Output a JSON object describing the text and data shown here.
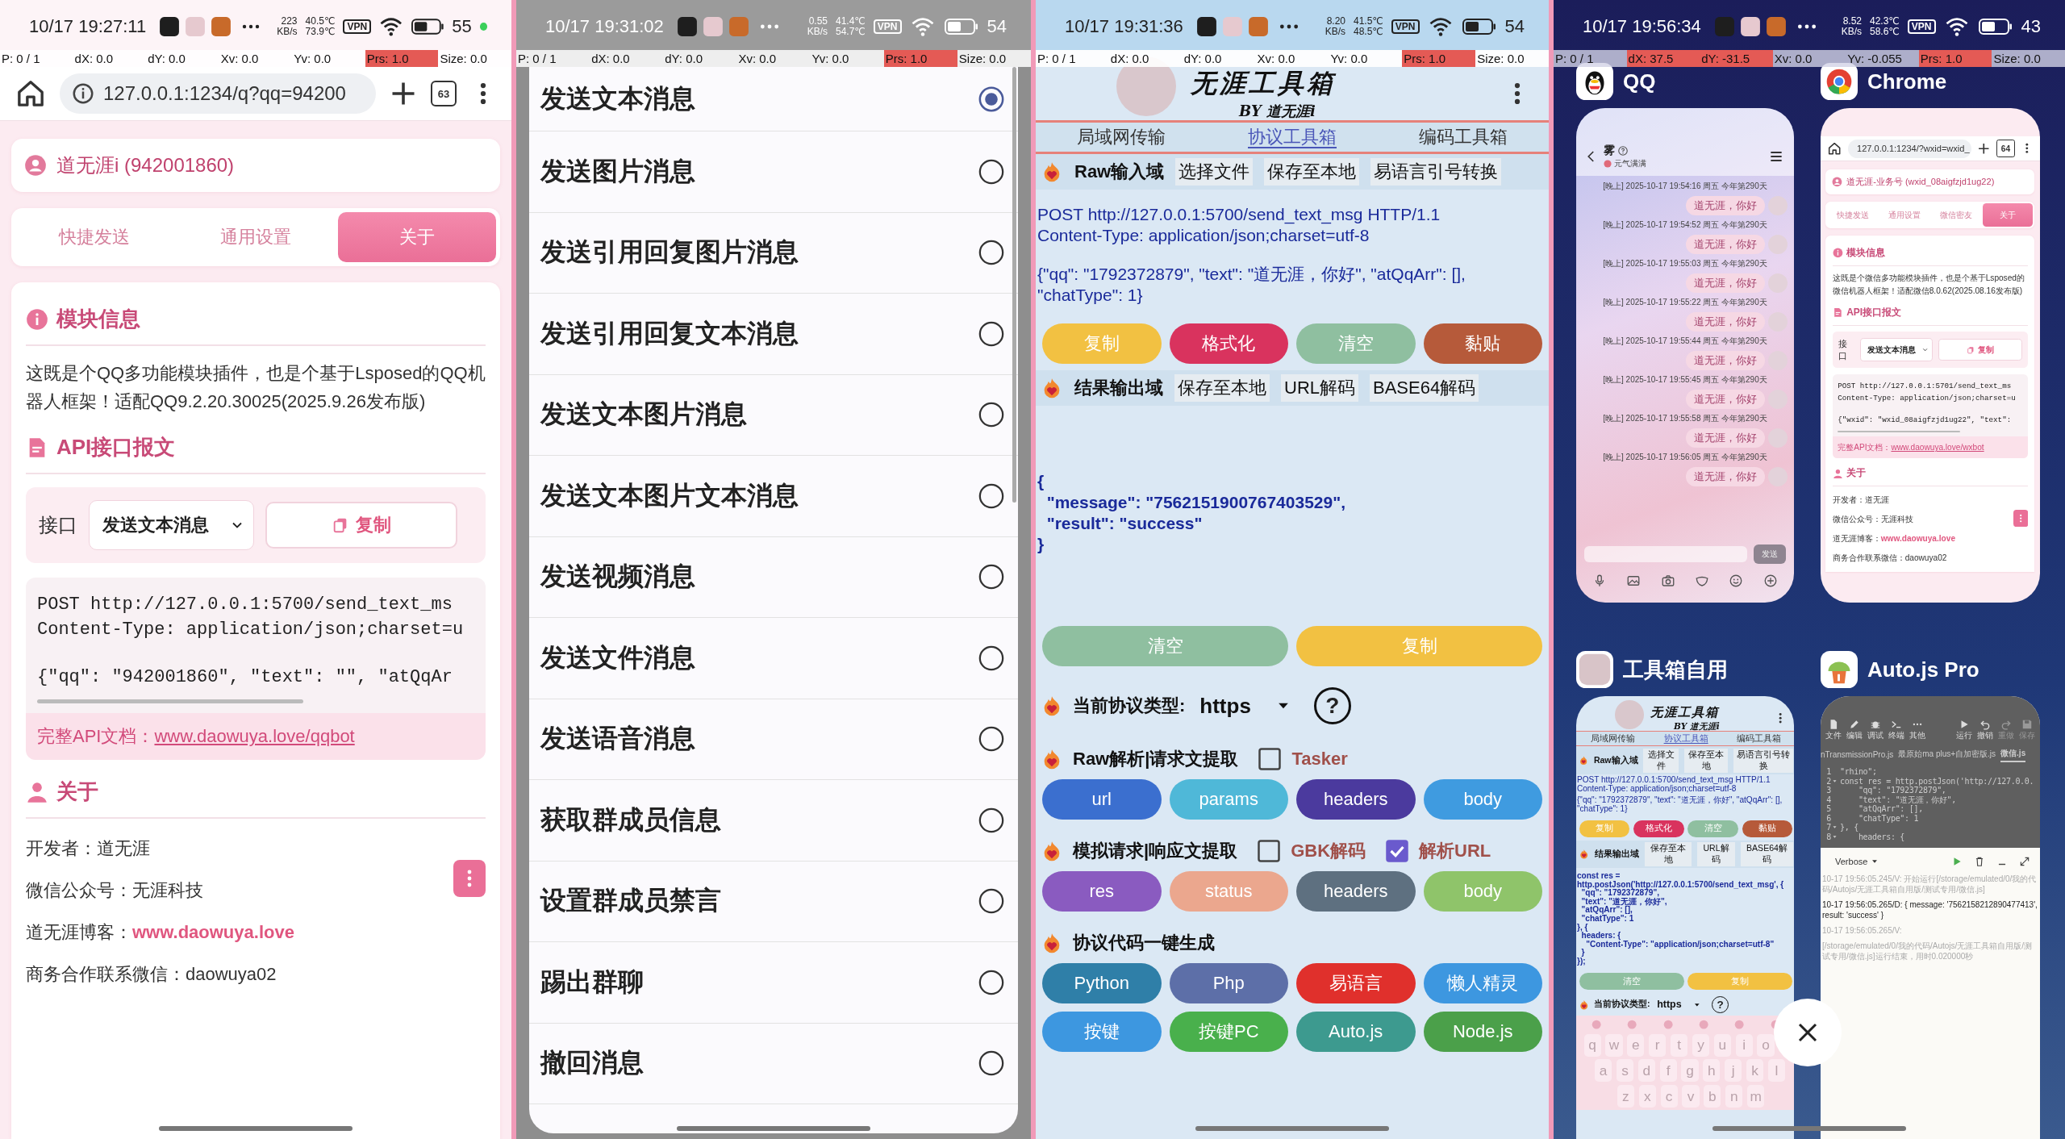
{
  "screens": [
    {
      "kind": "browser",
      "status_bar": {
        "time": "10/17 19:27:11",
        "net_speed": "223",
        "net_unit": "KB/s",
        "temp_1": "40.5℃",
        "temp_2": "73.9℃",
        "vpn": "VPN",
        "battery": "55",
        "charging_dot": true
      },
      "debug_bar": [
        {
          "text": "P: 0 / 1",
          "highlighted": false
        },
        {
          "text": "dX: 0.0",
          "highlighted": false
        },
        {
          "text": "dY: 0.0",
          "highlighted": false
        },
        {
          "text": "Xv: 0.0",
          "highlighted": false
        },
        {
          "text": "Yv: 0.0",
          "highlighted": false
        },
        {
          "text": "Prs: 1.0",
          "highlighted": true
        },
        {
          "text": "Size: 0.0",
          "highlighted": false
        }
      ],
      "toolbar": {
        "url": "127.0.0.1:1234/q?qq=94200",
        "tab_count": "63"
      },
      "account": "道无涯i (942001860)",
      "tabs": [
        {
          "label": "快捷发送",
          "selected": false
        },
        {
          "label": "通用设置",
          "selected": false
        },
        {
          "label": "关于",
          "selected": true
        }
      ],
      "module": {
        "title": "模块信息",
        "text": "这既是个QQ多功能模块插件，也是个基于Lsposed的QQ机器人框架！适配QQ9.2.20.30025(2025.9.26发布版)"
      },
      "api": {
        "title": "API接口报文",
        "label": "接口",
        "select": "发送文本消息",
        "copy": "复制",
        "code_blocks": [
          [
            "POST http://127.0.0.1:5700/send_text_ms",
            "Content-Type: application/json;charset=u"
          ],
          [
            "{\"qq\": \"942001860\", \"text\": \"\", \"atQqAr"
          ]
        ],
        "doc_label": "完整API文档：",
        "doc_link": "www.daowuya.love/qqbot"
      },
      "about": {
        "title": "关于",
        "lines": [
          {
            "text": "开发者：道无涯"
          },
          {
            "text": "微信公众号：无涯科技"
          },
          {
            "text": "道无涯博客：",
            "link": "www.daowuya.love"
          },
          {
            "text": "商务合作联系微信：daowuya02"
          }
        ]
      }
    },
    {
      "kind": "picker",
      "status_bar": {
        "time": "10/17 19:31:02",
        "net_speed": "0.55",
        "net_unit": "KB/s",
        "temp_1": "41.4℃",
        "temp_2": "54.7℃",
        "vpn": "VPN",
        "battery": "54",
        "charging_dot": false
      },
      "debug_bar": [
        {
          "text": "P: 0 / 1",
          "highlighted": false
        },
        {
          "text": "dX: 0.0",
          "highlighted": false
        },
        {
          "text": "dY: 0.0",
          "highlighted": false
        },
        {
          "text": "Xv: 0.0",
          "highlighted": false
        },
        {
          "text": "Yv: 0.0",
          "highlighted": false
        },
        {
          "text": "Prs: 1.0",
          "highlighted": true
        },
        {
          "text": "Size: 0.0",
          "highlighted": false
        }
      ],
      "options": [
        {
          "label": "发送文本消息",
          "selected": true
        },
        {
          "label": "发送图片消息",
          "selected": false
        },
        {
          "label": "发送引用回复图片消息",
          "selected": false
        },
        {
          "label": "发送引用回复文本消息",
          "selected": false
        },
        {
          "label": "发送文本图片消息",
          "selected": false
        },
        {
          "label": "发送文本图片文本消息",
          "selected": false
        },
        {
          "label": "发送视频消息",
          "selected": false
        },
        {
          "label": "发送文件消息",
          "selected": false
        },
        {
          "label": "发送语音消息",
          "selected": false
        },
        {
          "label": "获取群成员信息",
          "selected": false
        },
        {
          "label": "设置群成员禁言",
          "selected": false
        },
        {
          "label": "踢出群聊",
          "selected": false
        },
        {
          "label": "撤回消息",
          "selected": false
        }
      ]
    },
    {
      "kind": "toolbox",
      "status_bar": {
        "time": "10/17 19:31:36",
        "net_speed": "8.20",
        "net_unit": "KB/s",
        "temp_1": "41.5℃",
        "temp_2": "48.5℃",
        "vpn": "VPN",
        "battery": "54",
        "charging_dot": false
      },
      "debug_bar": [
        {
          "text": "P: 0 / 1",
          "highlighted": false
        },
        {
          "text": "dX: 0.0",
          "highlighted": false
        },
        {
          "text": "dY: 0.0",
          "highlighted": false
        },
        {
          "text": "Xv: 0.0",
          "highlighted": false
        },
        {
          "text": "Yv: 0.0",
          "highlighted": false
        },
        {
          "text": "Prs: 1.0",
          "highlighted": true
        },
        {
          "text": "Size: 0.0",
          "highlighted": false
        }
      ],
      "header": {
        "title": "无涯工具箱",
        "subtitle": "BY 道无涯i"
      },
      "tabs": [
        {
          "label": "局域网传输",
          "selected": false
        },
        {
          "label": "协议工具箱",
          "selected": true
        },
        {
          "label": "编码工具箱",
          "selected": false
        }
      ],
      "input": {
        "title": "Raw输入域",
        "actions": [
          "选择文件",
          "保存至本地",
          "易语言引号转换"
        ],
        "blocks": [
          [
            "POST http://127.0.0.1:5700/send_text_msg HTTP/1.1",
            "Content-Type: application/json;charset=utf-8"
          ],
          [
            "{\"qq\": \"1792372879\", \"text\": \"道无涯，你好\", \"atQqArr\": [], \"chatType\": 1}"
          ]
        ],
        "buttons": [
          {
            "label": "复制",
            "color": "#f2c142"
          },
          {
            "label": "格式化",
            "color": "#d9335e"
          },
          {
            "label": "清空",
            "color": "#8fbfa0"
          },
          {
            "label": "黏贴",
            "color": "#b65a3a"
          }
        ]
      },
      "output": {
        "title": "结果输出域",
        "actions": [
          "保存至本地",
          "URL解码",
          "BASE64解码"
        ],
        "blocks": [
          [
            "{",
            "  \"message\": \"7562151900767403529\",",
            "  \"result\": \"success\"",
            "}"
          ]
        ],
        "buttons": [
          {
            "label": "清空",
            "color": "#8fbfa0"
          },
          {
            "label": "复制",
            "color": "#f2c142"
          }
        ]
      },
      "protocol": {
        "label": "当前协议类型:",
        "value": "https",
        "help": "?"
      },
      "raw_parse": {
        "title": "Raw解析|请求文提取",
        "options": [
          {
            "label": "Tasker",
            "checked": false
          }
        ],
        "buttons": [
          {
            "label": "url",
            "color": "#3b6fcf"
          },
          {
            "label": "params",
            "color": "#4fb8d8"
          },
          {
            "label": "headers",
            "color": "#4b3a9e"
          },
          {
            "label": "body",
            "color": "#3f9be0"
          }
        ]
      },
      "mock": {
        "title": "模拟请求|响应文提取",
        "options": [
          {
            "label": "GBK解码",
            "checked": false
          },
          {
            "label": "解析URL",
            "checked": true
          }
        ],
        "buttons": [
          {
            "label": "res",
            "color": "#8a5bc0"
          },
          {
            "label": "status",
            "color": "#eba78e"
          },
          {
            "label": "headers",
            "color": "#5e7080"
          },
          {
            "label": "body",
            "color": "#8fc46a"
          }
        ]
      },
      "codegen": {
        "title": "协议代码一键生成",
        "buttons": [
          {
            "label": "Python",
            "color": "#2f7fa8"
          },
          {
            "label": "Php",
            "color": "#5d6fa8"
          },
          {
            "label": "易语言",
            "color": "#e0302c"
          },
          {
            "label": "懒人精灵",
            "color": "#3d97e0"
          },
          {
            "label": "按键",
            "color": "#3d97e0"
          },
          {
            "label": "按键PC",
            "color": "#49b04c"
          },
          {
            "label": "Auto.js",
            "color": "#3d9a8f"
          },
          {
            "label": "Node.js",
            "color": "#4ba04a"
          }
        ]
      }
    },
    {
      "kind": "recents",
      "status_bar": {
        "time": "10/17 19:56:34",
        "net_speed": "8.52",
        "net_unit": "KB/s",
        "temp_1": "42.3℃",
        "temp_2": "58.6℃",
        "vpn": "VPN",
        "battery": "43",
        "charging_dot": false
      },
      "debug_bar": [
        {
          "text": "P: 0 / 1",
          "highlighted": false
        },
        {
          "text": "dX: 37.5",
          "highlighted": true
        },
        {
          "text": "dY: -31.5",
          "highlighted": true
        },
        {
          "text": "Xv: 0.0",
          "highlighted": false
        },
        {
          "text": "Yv: -0.055",
          "highlighted": false
        },
        {
          "text": "Prs: 1.0",
          "highlighted": true
        },
        {
          "text": "Size: 0.0",
          "highlighted": false
        }
      ],
      "apps": [
        {
          "name": "QQ",
          "kind": "chat",
          "screen": {
            "contact": "雾",
            "status": "元气满满",
            "messages": [
              {
                "time": "[晚上] 2025-10-17 19:54:16 周五 今年第290天",
                "text": "道无涯，你好"
              },
              {
                "time": "[晚上] 2025-10-17 19:54:52 周五 今年第290天",
                "text": "道无涯，你好"
              },
              {
                "time": "[晚上] 2025-10-17 19:55:03 周五 今年第290天",
                "text": "道无涯，你好"
              },
              {
                "time": "[晚上] 2025-10-17 19:55:22 周五 今年第290天",
                "text": "道无涯，你好"
              },
              {
                "time": "[晚上] 2025-10-17 19:55:44 周五 今年第290天",
                "text": "道无涯，你好"
              },
              {
                "time": "[晚上] 2025-10-17 19:55:45 周五 今年第290天",
                "text": "道无涯，你好"
              },
              {
                "time": "[晚上] 2025-10-17 19:55:58 周五 今年第290天",
                "text": "道无涯，你好"
              },
              {
                "time": "[晚上] 2025-10-17 19:56:05 周五 今年第290天",
                "text": "道无涯，你好"
              }
            ],
            "send": "发送"
          }
        },
        {
          "name": "Chrome",
          "kind": "browser",
          "screen": {
            "toolbar": {
              "url": "127.0.0.1:1234/?wxid=wxid_",
              "tab_count": "64"
            },
            "account": "道无涯-业务号 (wxid_08aigfzjd1ug22)",
            "tabs": [
              {
                "label": "快捷发送",
                "selected": false
              },
              {
                "label": "通用设置",
                "selected": false
              },
              {
                "label": "微信密友",
                "selected": false
              },
              {
                "label": "关于",
                "selected": true
              }
            ],
            "module": {
              "title": "模块信息",
              "text": "这既是个微信多功能模块插件，也是个基于Lsposed的微信机器人框架！适配微信8.0.62(2025.08.16发布版)"
            },
            "api": {
              "title": "API接口报文",
              "label": "接口",
              "select": "发送文本消息",
              "copy": "复制",
              "code_blocks": [
                [
                  "POST http://127.0.0.1:5701/send_text_ms",
                  "Content-Type: application/json;charset=u"
                ],
                [
                  "{\"wxid\": \"wxid_08aigfzjd1ug22\", \"text\":"
                ]
              ],
              "doc_label": "完整API文档：",
              "doc_link": "www.daowuya.love/wxbot"
            },
            "about": {
              "title": "关于",
              "lines": [
                {
                  "text": "开发者：道无涯"
                },
                {
                  "text": "微信公众号：无涯科技"
                },
                {
                  "text": "道无涯博客：",
                  "link": "www.daowuya.love"
                },
                {
                  "text": "商务合作联系微信：daowuya02"
                }
              ]
            }
          }
        },
        {
          "name": "工具箱自用",
          "kind": "toolbox",
          "screen": {
            "header": {
              "title": "无涯工具箱",
              "subtitle": "BY 道无涯i"
            },
            "tabs": [
              {
                "label": "局域网传输",
                "selected": false
              },
              {
                "label": "协议工具箱",
                "selected": true
              },
              {
                "label": "编码工具箱",
                "selected": false
              }
            ],
            "input": {
              "title": "Raw输入域",
              "actions": [
                "选择文件",
                "保存至本地",
                "易语言引号转换"
              ],
              "blocks": [
                [
                  "POST http://127.0.0.1:5700/send_text_msg HTTP/1.1",
                  "Content-Type: application/json;charset=utf-8"
                ],
                [
                  "{\"qq\": \"1792372879\", \"text\": \"道无涯，你好\", \"atQqArr\": [], \"chatType\": 1}"
                ]
              ],
              "buttons": [
                {
                  "label": "复制",
                  "color": "#f2c142"
                },
                {
                  "label": "格式化",
                  "color": "#d9335e"
                },
                {
                  "label": "清空",
                  "color": "#8fbfa0"
                },
                {
                  "label": "黏贴",
                  "color": "#b65a3a"
                }
              ]
            },
            "output": {
              "title": "结果输出域",
              "actions": [
                "保存至本地",
                "URL解码",
                "BASE64解码"
              ],
              "blocks": [
                [
                  "const res = http.postJson('http://127.0.0.1:5700/send_text_msg', {",
                  "  \"qq\": \"1792372879\",",
                  "  \"text\": \"道无涯，你好\",",
                  "  \"atQqArr\": [],",
                  "  \"chatType\": 1",
                  "}, {",
                  "  headers: {",
                  "    \"Content-Type\": \"application/json;charset=utf-8\"",
                  "  }",
                  "});"
                ]
              ],
              "buttons": [
                {
                  "label": "清空",
                  "color": "#8fbfa0"
                },
                {
                  "label": "复制",
                  "color": "#f2c142"
                }
              ]
            },
            "protocol": {
              "label": "当前协议类型:",
              "value": "https",
              "help": "?"
            },
            "keyboard": [
              [
                "q",
                "w",
                "e",
                "r",
                "t",
                "y",
                "u",
                "i",
                "o"
              ],
              [
                "a",
                "s",
                "d",
                "f",
                "g",
                "h",
                "j",
                "k",
                "l"
              ],
              [
                "z",
                "x",
                "c",
                "v",
                "b",
                "n",
                "m"
              ]
            ]
          }
        },
        {
          "name": "Auto.js Pro",
          "kind": "editor",
          "screen": {
            "tools": [
              {
                "label": "文件",
                "disabled": false
              },
              {
                "label": "编辑",
                "disabled": false
              },
              {
                "label": "调试",
                "disabled": false
              },
              {
                "label": "终端",
                "disabled": false
              },
              {
                "label": "其他",
                "disabled": false
              },
              {
                "label": "运行",
                "disabled": false
              },
              {
                "label": "撤销",
                "disabled": false
              },
              {
                "label": "重做",
                "disabled": true
              },
              {
                "label": "保存",
                "disabled": true
              }
            ],
            "files": [
              {
                "name": "nTransmissionPro.js",
                "selected": false
              },
              {
                "name": "最原始ma plus+自加密版.js",
                "selected": false
              },
              {
                "name": "微信.js",
                "selected": true
              }
            ],
            "code": [
              {
                "line": "1",
                "text": "\"rhino\";",
                "foldable": false
              },
              {
                "line": "2",
                "text": "const res = http.postJson('http://127.0.0.",
                "foldable": true
              },
              {
                "line": "3",
                "text": "    \"qq\": \"1792372879\",",
                "foldable": false
              },
              {
                "line": "4",
                "text": "    \"text\": \"道无涯，你好\",",
                "foldable": false
              },
              {
                "line": "5",
                "text": "    \"atQqArr\": [],",
                "foldable": false
              },
              {
                "line": "6",
                "text": "    \"chatType\": 1",
                "foldable": false
              },
              {
                "line": "7",
                "text": "}, {",
                "foldable": true
              },
              {
                "line": "8",
                "text": "    headers: {",
                "foldable": true
              }
            ],
            "console": {
              "level": "Verbose",
              "logs": [
                {
                  "kind": "verbose",
                  "text": "10-17 19:56:05.245/V: 开始运行[/storage/emulated/0/我的代码/Autojs/无涯工具箱自用版/测试专用/微信.js]"
                },
                {
                  "kind": "debug",
                  "text": "10-17 19:56:05.265/D: { message: '7562158212890477413', result: 'success' }"
                },
                {
                  "kind": "verbose",
                  "text": "10-17 19:56:05.265/V:"
                },
                {
                  "kind": "verbose",
                  "text": "[/storage/emulated/0/我的代码/Autojs/无涯工具箱自用版/测试专用/微信.js]运行结束，用时0.020000秒"
                }
              ]
            }
          }
        }
      ]
    }
  ]
}
